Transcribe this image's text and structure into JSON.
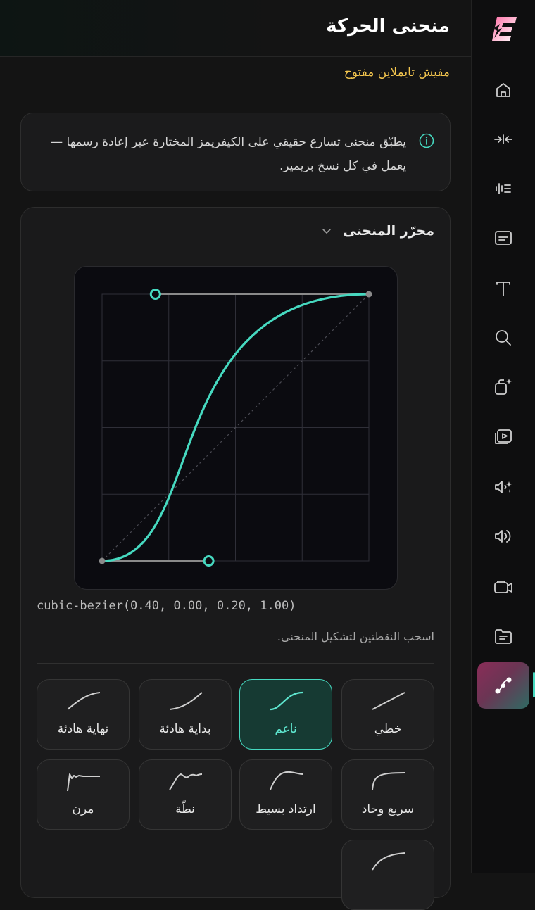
{
  "header": {
    "title": "منحنى الحركة"
  },
  "timeline_status": "مفيش تايملاين مفتوح",
  "info": {
    "text": "يطبّق منحنى تسارع حقيقي على الكيفريمز المختارة عبر إعادة رسمها — يعمل في كل نسخ بريمير."
  },
  "editor": {
    "title": "محرّر المنحنى",
    "bezier_code": "cubic-bezier(0.40, 0.00, 0.20, 1.00)",
    "hint": "اسحب النقطتين لتشكيل المنحنى.",
    "bezier": [
      0.4,
      0.0,
      0.2,
      1.0
    ]
  },
  "presets": [
    {
      "label": "خطي",
      "icon": "linear-curve-icon",
      "selected": false
    },
    {
      "label": "ناعم",
      "icon": "smooth-curve-icon",
      "selected": true
    },
    {
      "label": "بداية هادئة",
      "icon": "ease-in-curve-icon",
      "selected": false
    },
    {
      "label": "نهاية هادئة",
      "icon": "ease-out-curve-icon",
      "selected": false
    },
    {
      "label": "سريع وحاد",
      "icon": "fast-sharp-curve-icon",
      "selected": false
    },
    {
      "label": "ارتداد بسيط",
      "icon": "back-curve-icon",
      "selected": false
    },
    {
      "label": "نطّة",
      "icon": "bounce-curve-icon",
      "selected": false
    },
    {
      "label": "مرن",
      "icon": "elastic-curve-icon",
      "selected": false
    },
    {
      "label": "",
      "icon": "ease-out-curve-icon",
      "selected": false
    }
  ],
  "sidebar": {
    "items": [
      {
        "icon": "home-icon"
      },
      {
        "icon": "collapse-arrows-icon"
      },
      {
        "icon": "audio-levels-icon"
      },
      {
        "icon": "captions-icon"
      },
      {
        "icon": "text-icon"
      },
      {
        "icon": "search-icon"
      },
      {
        "icon": "ai-copy-icon"
      },
      {
        "icon": "media-library-icon"
      },
      {
        "icon": "ai-audio-icon"
      },
      {
        "icon": "volume-icon"
      },
      {
        "icon": "camera-icon"
      },
      {
        "icon": "folder-icon"
      },
      {
        "icon": "motion-curve-icon",
        "active": true
      }
    ]
  },
  "colors": {
    "accent": "#46d9c0",
    "warning": "#f4c64e",
    "background": "#141414"
  }
}
